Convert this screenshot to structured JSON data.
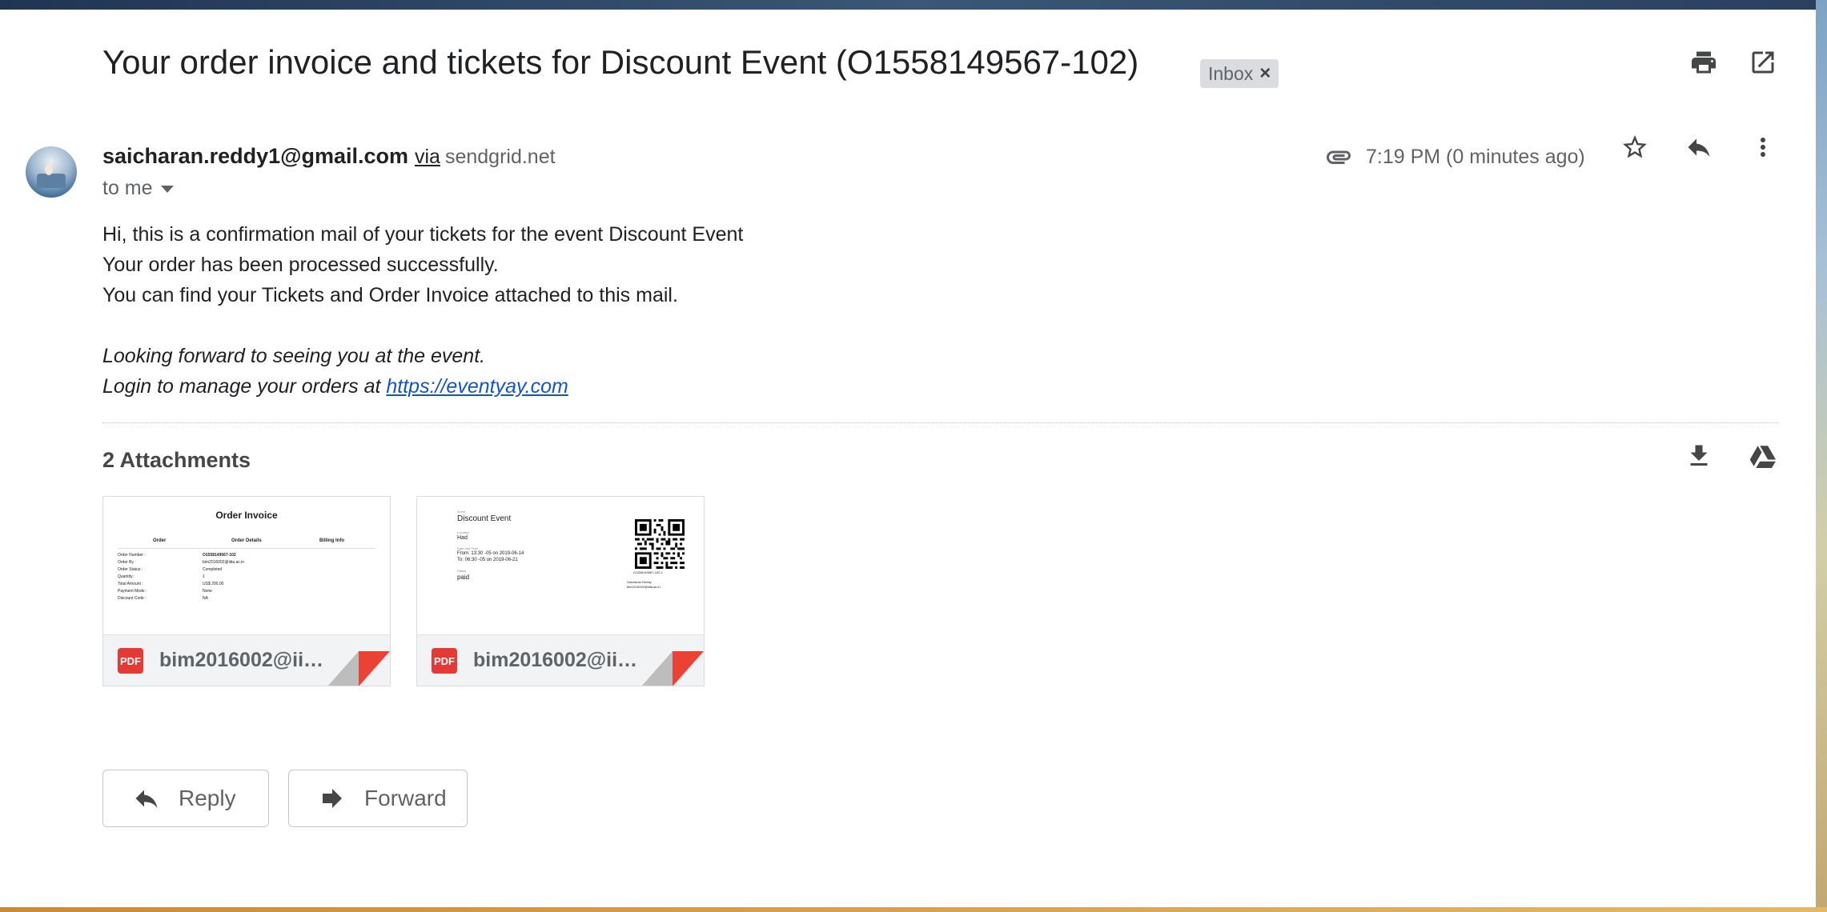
{
  "email": {
    "subject": "Your order invoice and tickets for Discount Event (O1558149567-102)",
    "label": "Inbox",
    "label_remove": "×",
    "sender_email": "saicharan.reddy1@gmail.com",
    "via_label": "via",
    "via_domain": "sendgrid.net",
    "recipient_summary": "to me",
    "time": "7:19 PM (0 minutes ago)",
    "body_lines": [
      "Hi, this is a confirmation mail of your tickets for the event Discount Event",
      "Your order has been processed successfully.",
      "You can find your Tickets and Order Invoice attached to this mail."
    ],
    "italic_lines": [
      "Looking forward to seeing you at the event.",
      "Login to manage your orders at "
    ],
    "link_text": "https://eventyay.com"
  },
  "attachments": {
    "heading": "2 Attachments",
    "items": [
      {
        "filename": "bim2016002@iiita....",
        "type_badge": "PDF",
        "preview": {
          "title": "Order Invoice",
          "columns": [
            "Order",
            "Order Details",
            "Billing Info"
          ],
          "rows": [
            [
              "Order Number :",
              "O1558149567-102"
            ],
            [
              "Order By :",
              "bim2016002@iiita.ac.in"
            ],
            [
              "Order Status :",
              "Completed"
            ],
            [
              "Quantity :",
              "1"
            ],
            [
              "Total Amount :",
              "US$ 200.00"
            ],
            [
              "Payment Mode :",
              "None"
            ],
            [
              "Discount Code :",
              "NA"
            ]
          ]
        }
      },
      {
        "filename": "bim2016002@iiita....",
        "type_badge": "PDF",
        "preview": {
          "event_caption": "Event",
          "event_name": "Discount Event",
          "location_caption": "Location",
          "location": "Had",
          "date_caption": "Date and Time",
          "from": "From: 13:30 -05 on 2019-06-14",
          "to": "To: 06:30 -05 on 2019-06-21",
          "status_caption": "Status",
          "status": "paid",
          "qr_caption": "O1558149567-102-1",
          "holder_name": "Saicharan Reddy",
          "holder_email": "bim2016002@iiita.ac.in"
        }
      }
    ]
  },
  "actions": {
    "reply_label": "Reply",
    "forward_label": "Forward"
  },
  "icons": {
    "print": "print-icon",
    "open_new": "open-in-new-window-icon",
    "paperclip": "paperclip-icon",
    "star": "star-icon",
    "reply": "reply-icon",
    "more": "more-vertical-icon",
    "download": "download-icon",
    "drive": "google-drive-icon",
    "forward": "forward-icon",
    "pdf": "pdf-icon"
  },
  "colors": {
    "link": "#1155cc",
    "pdf_badge": "#e53935",
    "label_chip": "#dadce0",
    "text_primary": "#202124",
    "text_secondary": "#5f6368"
  }
}
